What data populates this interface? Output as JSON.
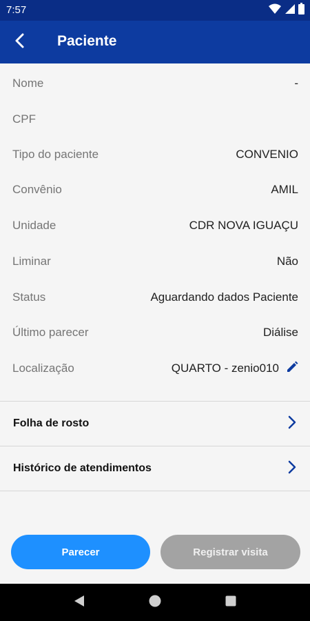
{
  "status_bar": {
    "time": "7:57",
    "icons": [
      "wifi-icon",
      "signal-icon",
      "battery-icon"
    ]
  },
  "app_bar": {
    "title": "Paciente",
    "back_icon": "arrow-back-icon",
    "color": "#0d3ba0"
  },
  "fields": [
    {
      "label": "Nome",
      "value": "-"
    },
    {
      "label": "CPF",
      "value": ""
    },
    {
      "label": "Tipo do paciente",
      "value": "CONVENIO"
    },
    {
      "label": "Convênio",
      "value": "AMIL"
    },
    {
      "label": "Unidade",
      "value": "CDR NOVA IGUAÇU"
    },
    {
      "label": "Liminar",
      "value": "Não"
    },
    {
      "label": "Status",
      "value": "Aguardando dados Paciente"
    },
    {
      "label": "Último parecer",
      "value": "Diálise"
    },
    {
      "label": "Localização",
      "value": "QUARTO - zenio010",
      "icon": "edit-pencil-icon"
    }
  ],
  "nav_items": [
    {
      "label": "Folha de rosto",
      "icon": "chevron-right-icon"
    },
    {
      "label": "Histórico de atendimentos",
      "icon": "chevron-right-icon"
    }
  ],
  "actions": {
    "parecer_label": "Parecer",
    "registrar_label": "Registrar visita",
    "primary_color": "#1e90ff",
    "disabled_color": "#a3a3a3"
  },
  "system_nav": {
    "icons": [
      "back-triangle-icon",
      "home-circle-icon",
      "recents-square-icon"
    ]
  }
}
